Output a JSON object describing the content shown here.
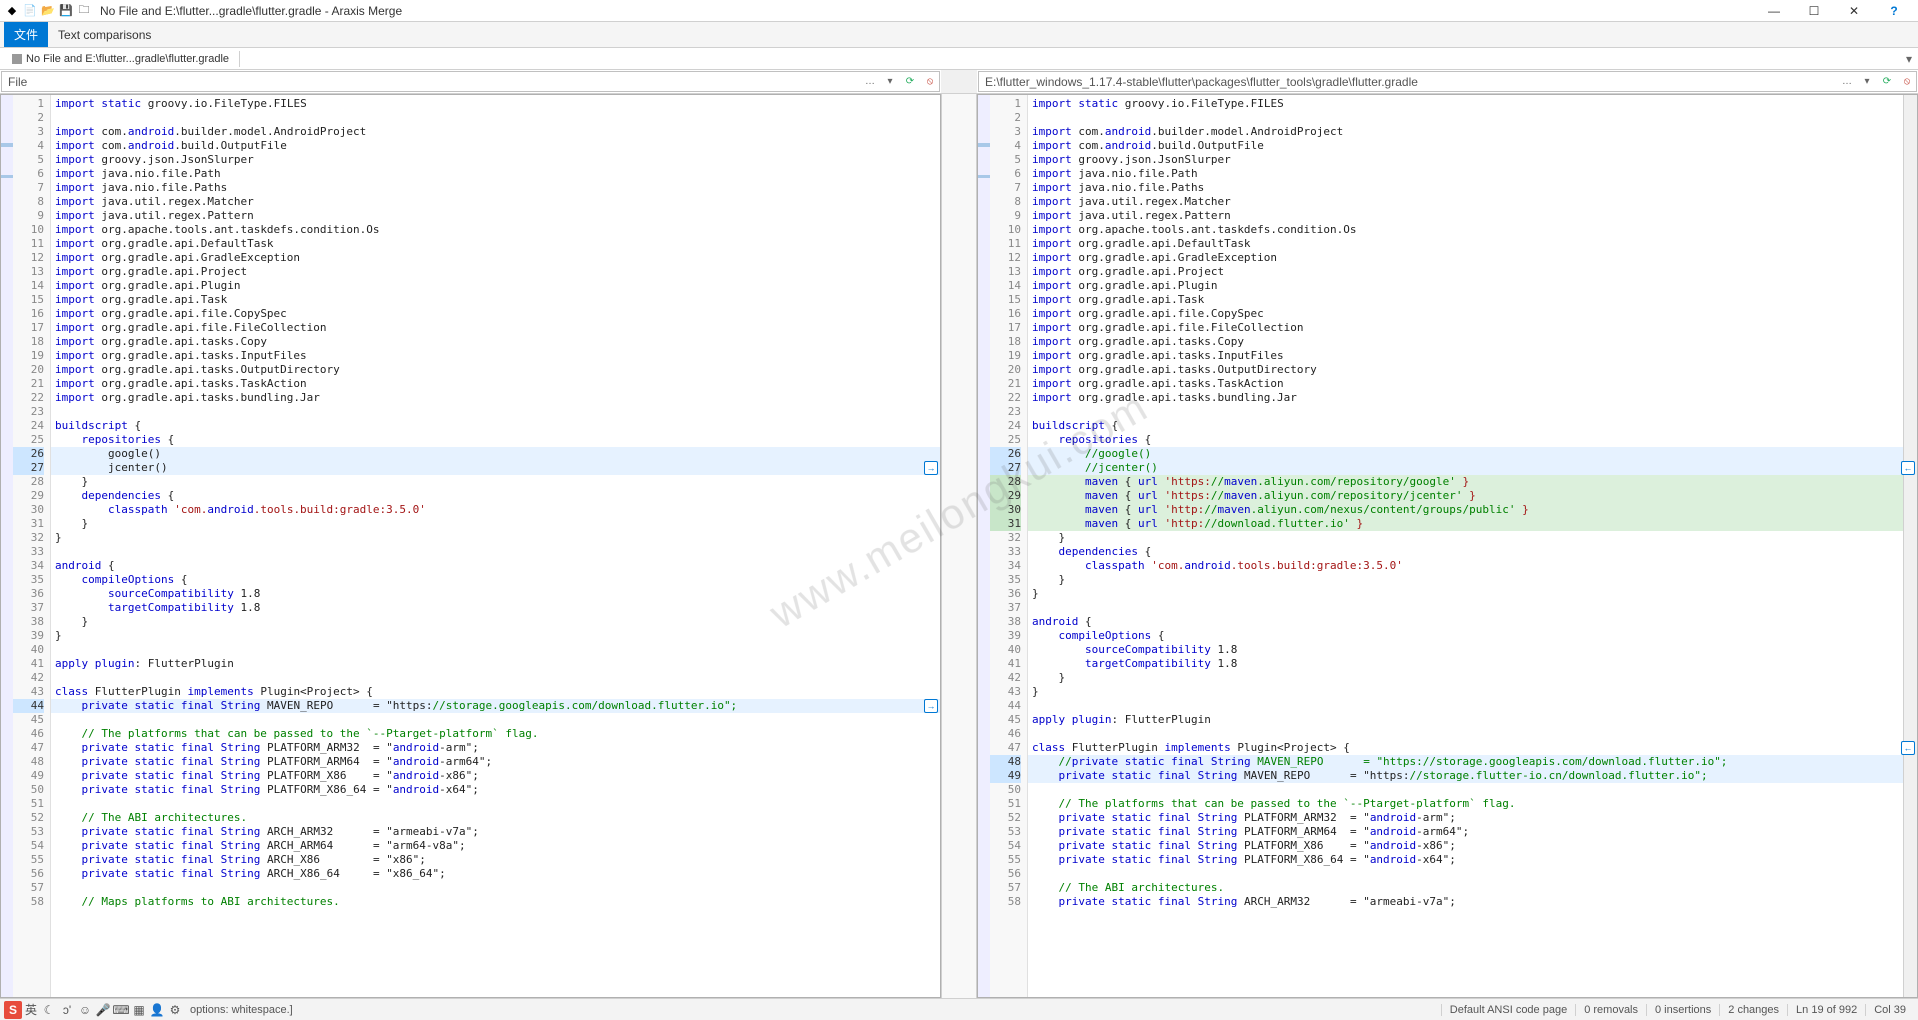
{
  "window": {
    "title": "No File and E:\\flutter...gradle\\flutter.gradle - Araxis Merge"
  },
  "menu": {
    "file": "文件",
    "textcmp": "Text comparisons"
  },
  "tab": {
    "label": "No File and E:\\flutter...gradle\\flutter.gradle"
  },
  "paths": {
    "left": "File",
    "right": "E:\\flutter_windows_1.17.4-stable\\flutter\\packages\\flutter_tools\\gradle\\flutter.gradle"
  },
  "left_lines": [
    {
      "n": 1,
      "t": "import static groovy.io.FileType.FILES"
    },
    {
      "n": 2,
      "t": ""
    },
    {
      "n": 3,
      "t": "import com.android.builder.model.AndroidProject"
    },
    {
      "n": 4,
      "t": "import com.android.build.OutputFile"
    },
    {
      "n": 5,
      "t": "import groovy.json.JsonSlurper"
    },
    {
      "n": 6,
      "t": "import java.nio.file.Path"
    },
    {
      "n": 7,
      "t": "import java.nio.file.Paths"
    },
    {
      "n": 8,
      "t": "import java.util.regex.Matcher"
    },
    {
      "n": 9,
      "t": "import java.util.regex.Pattern"
    },
    {
      "n": 10,
      "t": "import org.apache.tools.ant.taskdefs.condition.Os"
    },
    {
      "n": 11,
      "t": "import org.gradle.api.DefaultTask"
    },
    {
      "n": 12,
      "t": "import org.gradle.api.GradleException"
    },
    {
      "n": 13,
      "t": "import org.gradle.api.Project"
    },
    {
      "n": 14,
      "t": "import org.gradle.api.Plugin"
    },
    {
      "n": 15,
      "t": "import org.gradle.api.Task"
    },
    {
      "n": 16,
      "t": "import org.gradle.api.file.CopySpec"
    },
    {
      "n": 17,
      "t": "import org.gradle.api.file.FileCollection"
    },
    {
      "n": 18,
      "t": "import org.gradle.api.tasks.Copy"
    },
    {
      "n": 19,
      "t": "import org.gradle.api.tasks.InputFiles"
    },
    {
      "n": 20,
      "t": "import org.gradle.api.tasks.OutputDirectory"
    },
    {
      "n": 21,
      "t": "import org.gradle.api.tasks.TaskAction"
    },
    {
      "n": 22,
      "t": "import org.gradle.api.tasks.bundling.Jar"
    },
    {
      "n": 23,
      "t": ""
    },
    {
      "n": 24,
      "t": "buildscript {"
    },
    {
      "n": 25,
      "t": "    repositories {"
    },
    {
      "n": 26,
      "t": "        google()",
      "cls": "chg"
    },
    {
      "n": 27,
      "t": "        jcenter()",
      "cls": "chg"
    },
    {
      "n": 28,
      "t": "    }"
    },
    {
      "n": 29,
      "t": "    dependencies {"
    },
    {
      "n": 30,
      "t": "        classpath 'com.android.tools.build:gradle:3.5.0'"
    },
    {
      "n": 31,
      "t": "    }"
    },
    {
      "n": 32,
      "t": "}"
    },
    {
      "n": 33,
      "t": ""
    },
    {
      "n": 34,
      "t": "android {"
    },
    {
      "n": 35,
      "t": "    compileOptions {"
    },
    {
      "n": 36,
      "t": "        sourceCompatibility 1.8"
    },
    {
      "n": 37,
      "t": "        targetCompatibility 1.8"
    },
    {
      "n": 38,
      "t": "    }"
    },
    {
      "n": 39,
      "t": "}"
    },
    {
      "n": 40,
      "t": ""
    },
    {
      "n": 41,
      "t": "apply plugin: FlutterPlugin"
    },
    {
      "n": 42,
      "t": ""
    },
    {
      "n": 43,
      "t": "class FlutterPlugin implements Plugin<Project> {"
    },
    {
      "n": 44,
      "t": "    private static final String MAVEN_REPO      = \"https://storage.googleapis.com/download.flutter.io\";",
      "cls": "chg"
    },
    {
      "n": 45,
      "t": ""
    },
    {
      "n": 46,
      "t": "    // The platforms that can be passed to the `--Ptarget-platform` flag."
    },
    {
      "n": 47,
      "t": "    private static final String PLATFORM_ARM32  = \"android-arm\";"
    },
    {
      "n": 48,
      "t": "    private static final String PLATFORM_ARM64  = \"android-arm64\";"
    },
    {
      "n": 49,
      "t": "    private static final String PLATFORM_X86    = \"android-x86\";"
    },
    {
      "n": 50,
      "t": "    private static final String PLATFORM_X86_64 = \"android-x64\";"
    },
    {
      "n": 51,
      "t": ""
    },
    {
      "n": 52,
      "t": "    // The ABI architectures."
    },
    {
      "n": 53,
      "t": "    private static final String ARCH_ARM32      = \"armeabi-v7a\";"
    },
    {
      "n": 54,
      "t": "    private static final String ARCH_ARM64      = \"arm64-v8a\";"
    },
    {
      "n": 55,
      "t": "    private static final String ARCH_X86        = \"x86\";"
    },
    {
      "n": 56,
      "t": "    private static final String ARCH_X86_64     = \"x86_64\";"
    },
    {
      "n": 57,
      "t": ""
    },
    {
      "n": 58,
      "t": "    // Maps platforms to ABI architectures."
    }
  ],
  "right_lines": [
    {
      "n": 1,
      "t": "import static groovy.io.FileType.FILES"
    },
    {
      "n": 2,
      "t": ""
    },
    {
      "n": 3,
      "t": "import com.android.builder.model.AndroidProject"
    },
    {
      "n": 4,
      "t": "import com.android.build.OutputFile"
    },
    {
      "n": 5,
      "t": "import groovy.json.JsonSlurper"
    },
    {
      "n": 6,
      "t": "import java.nio.file.Path"
    },
    {
      "n": 7,
      "t": "import java.nio.file.Paths"
    },
    {
      "n": 8,
      "t": "import java.util.regex.Matcher"
    },
    {
      "n": 9,
      "t": "import java.util.regex.Pattern"
    },
    {
      "n": 10,
      "t": "import org.apache.tools.ant.taskdefs.condition.Os"
    },
    {
      "n": 11,
      "t": "import org.gradle.api.DefaultTask"
    },
    {
      "n": 12,
      "t": "import org.gradle.api.GradleException"
    },
    {
      "n": 13,
      "t": "import org.gradle.api.Project"
    },
    {
      "n": 14,
      "t": "import org.gradle.api.Plugin"
    },
    {
      "n": 15,
      "t": "import org.gradle.api.Task"
    },
    {
      "n": 16,
      "t": "import org.gradle.api.file.CopySpec"
    },
    {
      "n": 17,
      "t": "import org.gradle.api.file.FileCollection"
    },
    {
      "n": 18,
      "t": "import org.gradle.api.tasks.Copy"
    },
    {
      "n": 19,
      "t": "import org.gradle.api.tasks.InputFiles"
    },
    {
      "n": 20,
      "t": "import org.gradle.api.tasks.OutputDirectory"
    },
    {
      "n": 21,
      "t": "import org.gradle.api.tasks.TaskAction"
    },
    {
      "n": 22,
      "t": "import org.gradle.api.tasks.bundling.Jar"
    },
    {
      "n": 23,
      "t": ""
    },
    {
      "n": 24,
      "t": "buildscript {"
    },
    {
      "n": 25,
      "t": "    repositories {"
    },
    {
      "n": 26,
      "t": "        //google()",
      "cls": "chg"
    },
    {
      "n": 27,
      "t": "        //jcenter()",
      "cls": "chg"
    },
    {
      "n": 28,
      "t": "        maven { url 'https://maven.aliyun.com/repository/google' }",
      "cls": "ins"
    },
    {
      "n": 29,
      "t": "        maven { url 'https://maven.aliyun.com/repository/jcenter' }",
      "cls": "ins"
    },
    {
      "n": 30,
      "t": "        maven { url 'http://maven.aliyun.com/nexus/content/groups/public' }",
      "cls": "ins"
    },
    {
      "n": 31,
      "t": "        maven { url 'http://download.flutter.io' }",
      "cls": "ins"
    },
    {
      "n": 32,
      "t": "    }"
    },
    {
      "n": 33,
      "t": "    dependencies {"
    },
    {
      "n": 34,
      "t": "        classpath 'com.android.tools.build:gradle:3.5.0'"
    },
    {
      "n": 35,
      "t": "    }"
    },
    {
      "n": 36,
      "t": "}"
    },
    {
      "n": 37,
      "t": ""
    },
    {
      "n": 38,
      "t": "android {"
    },
    {
      "n": 39,
      "t": "    compileOptions {"
    },
    {
      "n": 40,
      "t": "        sourceCompatibility 1.8"
    },
    {
      "n": 41,
      "t": "        targetCompatibility 1.8"
    },
    {
      "n": 42,
      "t": "    }"
    },
    {
      "n": 43,
      "t": "}"
    },
    {
      "n": 44,
      "t": ""
    },
    {
      "n": 45,
      "t": "apply plugin: FlutterPlugin"
    },
    {
      "n": 46,
      "t": ""
    },
    {
      "n": 47,
      "t": "class FlutterPlugin implements Plugin<Project> {"
    },
    {
      "n": 48,
      "t": "    //private static final String MAVEN_REPO      = \"https://storage.googleapis.com/download.flutter.io\";",
      "cls": "chg"
    },
    {
      "n": 49,
      "t": "    private static final String MAVEN_REPO      = \"https://storage.flutter-io.cn/download.flutter.io\";",
      "cls": "chg"
    },
    {
      "n": 50,
      "t": ""
    },
    {
      "n": 51,
      "t": "    // The platforms that can be passed to the `--Ptarget-platform` flag."
    },
    {
      "n": 52,
      "t": "    private static final String PLATFORM_ARM32  = \"android-arm\";"
    },
    {
      "n": 53,
      "t": "    private static final String PLATFORM_ARM64  = \"android-arm64\";"
    },
    {
      "n": 54,
      "t": "    private static final String PLATFORM_X86    = \"android-x86\";"
    },
    {
      "n": 55,
      "t": "    private static final String PLATFORM_X86_64 = \"android-x64\";"
    },
    {
      "n": 56,
      "t": ""
    },
    {
      "n": 57,
      "t": "    // The ABI architectures."
    },
    {
      "n": 58,
      "t": "    private static final String ARCH_ARM32      = \"armeabi-v7a\";"
    }
  ],
  "status": {
    "options": "options: whitespace.]",
    "codepage": "Default ANSI code page",
    "removals": "0 removals",
    "insertions": "0 insertions",
    "changes": "2 changes",
    "pos": "Ln 19 of 992",
    "col": "Col 39"
  },
  "watermark": "www.meilongkui.com"
}
